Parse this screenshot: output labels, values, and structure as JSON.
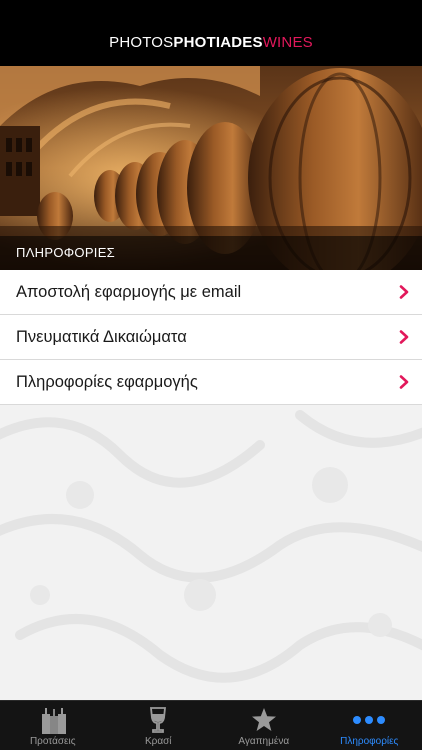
{
  "header": {
    "brand_part1": "PHOTOS",
    "brand_part2": "PHOTIADES",
    "brand_part3": "WINES",
    "accent_color": "#e2185b"
  },
  "hero": {
    "caption": "ΠΛΗΡΟΦΟΡΙΕΣ"
  },
  "menu": {
    "items": [
      {
        "label": "Αποστολή εφαρμογής με email",
        "icon": "chevron-right-icon"
      },
      {
        "label": "Πνευματικά Δικαιώματα",
        "icon": "chevron-right-icon"
      },
      {
        "label": "Πληροφορίες εφαρμογής",
        "icon": "chevron-right-icon"
      }
    ]
  },
  "tabbar": {
    "tabs": [
      {
        "label": "Προτάσεις",
        "icon": "bottles-icon",
        "active": false
      },
      {
        "label": "Κρασί",
        "icon": "wine-glass-icon",
        "active": false
      },
      {
        "label": "Αγαπημένα",
        "icon": "star-icon",
        "active": false
      },
      {
        "label": "Πληροφορίες",
        "icon": "more-dots-icon",
        "active": true
      }
    ],
    "active_color": "#2d8cff"
  }
}
